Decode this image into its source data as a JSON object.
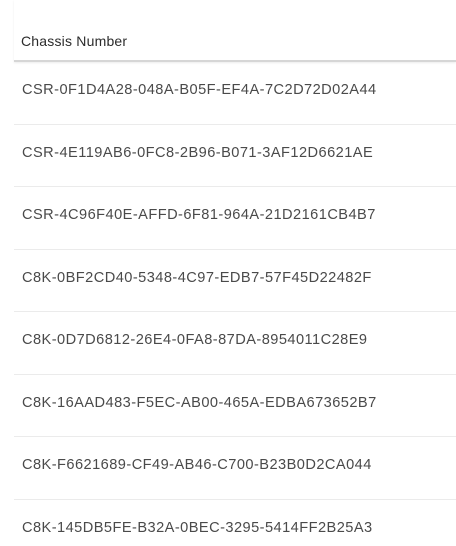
{
  "table": {
    "column_header": "Chassis Number",
    "rows": [
      "CSR-0F1D4A28-048A-B05F-EF4A-7C2D72D02A44",
      "CSR-4E119AB6-0FC8-2B96-B071-3AF12D6621AE",
      "CSR-4C96F40E-AFFD-6F81-964A-21D2161CB4B7",
      "C8K-0BF2CD40-5348-4C97-EDB7-57F45D22482F",
      "C8K-0D7D6812-26E4-0FA8-87DA-8954011C28E9",
      "C8K-16AAD483-F5EC-AB00-465A-EDBA673652B7",
      "C8K-F6621689-CF49-AB46-C700-B23B0D2CA044",
      "C8K-145DB5FE-B32A-0BEC-3295-5414FF2B25A3"
    ]
  }
}
